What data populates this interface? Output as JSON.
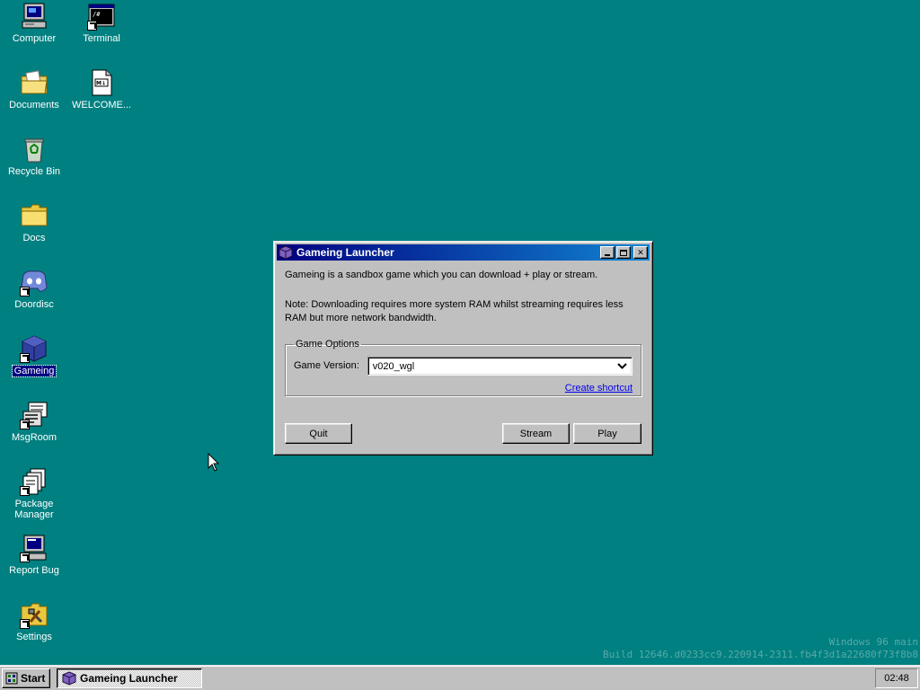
{
  "desktop": {
    "icons": [
      {
        "label": "Computer",
        "icon": "computer-icon"
      },
      {
        "label": "Terminal",
        "icon": "terminal-icon"
      },
      {
        "label": "Documents",
        "icon": "documents-folder-icon"
      },
      {
        "label": "WELCOME...",
        "icon": "markdown-file-icon"
      },
      {
        "label": "Recycle Bin",
        "icon": "recycle-bin-icon"
      },
      {
        "label": "Docs",
        "icon": "folder-icon"
      },
      {
        "label": "Doordisc",
        "icon": "doordisc-icon"
      },
      {
        "label": "Gameing",
        "icon": "gameing-cube-icon"
      },
      {
        "label": "MsgRoom",
        "icon": "msgroom-icon"
      },
      {
        "label": "Package Manager",
        "icon": "package-manager-icon"
      },
      {
        "label": "Report Bug",
        "icon": "report-bug-icon"
      },
      {
        "label": "Settings",
        "icon": "settings-icon"
      }
    ],
    "selected_icon": "Gameing"
  },
  "window": {
    "title": "Gameing Launcher",
    "description": "Gameing is a sandbox game which you can download + play or stream.",
    "note": "Note: Downloading requires more system RAM whilst streaming requires less RAM but more network bandwidth.",
    "group_label": "Game Options",
    "version_label": "Game Version:",
    "version_value": "v020_wgl",
    "shortcut_link": "Create shortcut",
    "buttons": {
      "quit": "Quit",
      "stream": "Stream",
      "play": "Play"
    }
  },
  "taskbar": {
    "start_label": "Start",
    "task_label": "Gameing Launcher",
    "clock": "02:48"
  },
  "watermark": {
    "line1": "Windows 96 main",
    "line2": "Build 12646.d0233cc9.220914-2311.fb4f3d1a22680f73f8b8"
  },
  "colors": {
    "desktop": "#008080",
    "titlebar": "#000080",
    "face": "#c0c0c0"
  }
}
